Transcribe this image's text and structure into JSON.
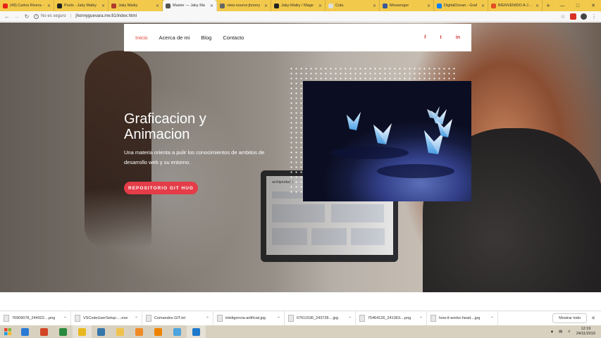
{
  "browser": {
    "tabs": [
      {
        "label": "(49) Carlos Rivera - ",
        "icon_color": "#e62117",
        "active": false
      },
      {
        "label": "Posts - Jaky Maiky",
        "icon_color": "#222222",
        "active": false
      },
      {
        "label": "Jaky Maiky",
        "icon_color": "#b03a2e",
        "active": false
      },
      {
        "label": "Master — Jaky Ma",
        "icon_color": "#555555",
        "active": true
      },
      {
        "label": "view-source:jhonny",
        "icon_color": "#666666",
        "active": false
      },
      {
        "label": "Jaky-Maiky / Mage",
        "icon_color": "#222222",
        "active": false
      },
      {
        "label": "Cula",
        "icon_color": "#dddddd",
        "active": false
      },
      {
        "label": "Messenger",
        "icon_color": "#3b5998",
        "active": false
      },
      {
        "label": "DigitalOcean - Graf",
        "icon_color": "#0080ff",
        "active": false
      },
      {
        "label": "BIENVENIDO A JAK",
        "icon_color": "#e44d26",
        "active": false
      }
    ],
    "new_tab": "+",
    "address": {
      "security_label": "No es seguro",
      "separator": "|",
      "url": "jhonnyguevara.me:81/index.html"
    }
  },
  "site": {
    "nav": {
      "links": [
        "Inicio",
        "Acerca de mi",
        "Blog",
        "Contacto"
      ],
      "active_index": 0,
      "social": [
        "f",
        "t",
        "in"
      ]
    },
    "hero": {
      "title_line1": "Graficacion y",
      "title_line2": "Animacion",
      "subtitle": "Una materia orienta a pulir los conocimientos de ambitos de desarrollo web y su entorno.",
      "button_label": "REPOSITORIO GIT HUG"
    },
    "laptop_screen_text": "archiproducts",
    "colors": {
      "accent": "#e43c48",
      "nav_active": "#e0483a",
      "social": "#d63b3b"
    }
  },
  "downloads": {
    "items": [
      "76909078_244922....png",
      "VSCodeUserSetup-....exe",
      "Comandos GIT.txt",
      "inteligencia-artificial.jpg",
      "67611536_243728....jpg",
      "75464126_241363....png",
      "how-it-works-head....jpg"
    ],
    "show_all_label": "Mostrar todo"
  },
  "taskbar": {
    "apps": [
      {
        "name": "explorer-icon",
        "color": "#2b7bd6"
      },
      {
        "name": "powerpoint-icon",
        "color": "#d24726"
      },
      {
        "name": "project-icon",
        "color": "#2a8a3e"
      },
      {
        "name": "chrome-icon",
        "color": "#e8b820"
      },
      {
        "name": "python-icon",
        "color": "#3776ab"
      },
      {
        "name": "file-explorer-icon",
        "color": "#f0c24b"
      },
      {
        "name": "media-player-icon",
        "color": "#f08a24"
      },
      {
        "name": "vlc-icon",
        "color": "#ef8200"
      },
      {
        "name": "paint-icon",
        "color": "#4ca3dd"
      },
      {
        "name": "vscode-icon",
        "color": "#1f7acc"
      }
    ],
    "time": "12:19",
    "date": "24/11/2019"
  }
}
